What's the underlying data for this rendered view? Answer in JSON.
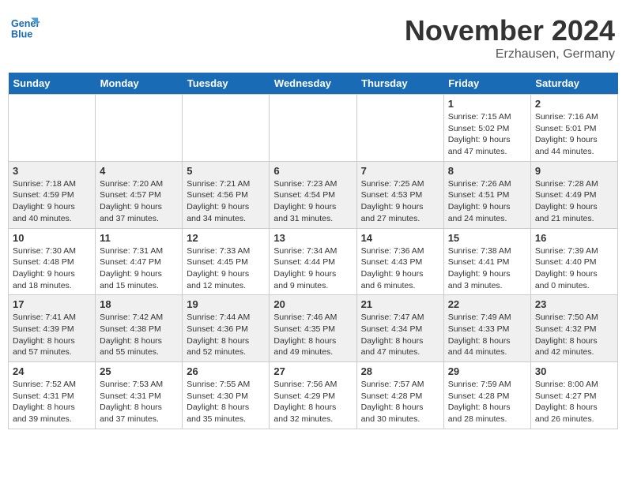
{
  "header": {
    "title": "November 2024",
    "location": "Erzhausen, Germany",
    "logo_line1": "General",
    "logo_line2": "Blue"
  },
  "days_of_week": [
    "Sunday",
    "Monday",
    "Tuesday",
    "Wednesday",
    "Thursday",
    "Friday",
    "Saturday"
  ],
  "weeks": [
    [
      {
        "day": "",
        "info": ""
      },
      {
        "day": "",
        "info": ""
      },
      {
        "day": "",
        "info": ""
      },
      {
        "day": "",
        "info": ""
      },
      {
        "day": "",
        "info": ""
      },
      {
        "day": "1",
        "info": "Sunrise: 7:15 AM\nSunset: 5:02 PM\nDaylight: 9 hours and 47 minutes."
      },
      {
        "day": "2",
        "info": "Sunrise: 7:16 AM\nSunset: 5:01 PM\nDaylight: 9 hours and 44 minutes."
      }
    ],
    [
      {
        "day": "3",
        "info": "Sunrise: 7:18 AM\nSunset: 4:59 PM\nDaylight: 9 hours and 40 minutes."
      },
      {
        "day": "4",
        "info": "Sunrise: 7:20 AM\nSunset: 4:57 PM\nDaylight: 9 hours and 37 minutes."
      },
      {
        "day": "5",
        "info": "Sunrise: 7:21 AM\nSunset: 4:56 PM\nDaylight: 9 hours and 34 minutes."
      },
      {
        "day": "6",
        "info": "Sunrise: 7:23 AM\nSunset: 4:54 PM\nDaylight: 9 hours and 31 minutes."
      },
      {
        "day": "7",
        "info": "Sunrise: 7:25 AM\nSunset: 4:53 PM\nDaylight: 9 hours and 27 minutes."
      },
      {
        "day": "8",
        "info": "Sunrise: 7:26 AM\nSunset: 4:51 PM\nDaylight: 9 hours and 24 minutes."
      },
      {
        "day": "9",
        "info": "Sunrise: 7:28 AM\nSunset: 4:49 PM\nDaylight: 9 hours and 21 minutes."
      }
    ],
    [
      {
        "day": "10",
        "info": "Sunrise: 7:30 AM\nSunset: 4:48 PM\nDaylight: 9 hours and 18 minutes."
      },
      {
        "day": "11",
        "info": "Sunrise: 7:31 AM\nSunset: 4:47 PM\nDaylight: 9 hours and 15 minutes."
      },
      {
        "day": "12",
        "info": "Sunrise: 7:33 AM\nSunset: 4:45 PM\nDaylight: 9 hours and 12 minutes."
      },
      {
        "day": "13",
        "info": "Sunrise: 7:34 AM\nSunset: 4:44 PM\nDaylight: 9 hours and 9 minutes."
      },
      {
        "day": "14",
        "info": "Sunrise: 7:36 AM\nSunset: 4:43 PM\nDaylight: 9 hours and 6 minutes."
      },
      {
        "day": "15",
        "info": "Sunrise: 7:38 AM\nSunset: 4:41 PM\nDaylight: 9 hours and 3 minutes."
      },
      {
        "day": "16",
        "info": "Sunrise: 7:39 AM\nSunset: 4:40 PM\nDaylight: 9 hours and 0 minutes."
      }
    ],
    [
      {
        "day": "17",
        "info": "Sunrise: 7:41 AM\nSunset: 4:39 PM\nDaylight: 8 hours and 57 minutes."
      },
      {
        "day": "18",
        "info": "Sunrise: 7:42 AM\nSunset: 4:38 PM\nDaylight: 8 hours and 55 minutes."
      },
      {
        "day": "19",
        "info": "Sunrise: 7:44 AM\nSunset: 4:36 PM\nDaylight: 8 hours and 52 minutes."
      },
      {
        "day": "20",
        "info": "Sunrise: 7:46 AM\nSunset: 4:35 PM\nDaylight: 8 hours and 49 minutes."
      },
      {
        "day": "21",
        "info": "Sunrise: 7:47 AM\nSunset: 4:34 PM\nDaylight: 8 hours and 47 minutes."
      },
      {
        "day": "22",
        "info": "Sunrise: 7:49 AM\nSunset: 4:33 PM\nDaylight: 8 hours and 44 minutes."
      },
      {
        "day": "23",
        "info": "Sunrise: 7:50 AM\nSunset: 4:32 PM\nDaylight: 8 hours and 42 minutes."
      }
    ],
    [
      {
        "day": "24",
        "info": "Sunrise: 7:52 AM\nSunset: 4:31 PM\nDaylight: 8 hours and 39 minutes."
      },
      {
        "day": "25",
        "info": "Sunrise: 7:53 AM\nSunset: 4:31 PM\nDaylight: 8 hours and 37 minutes."
      },
      {
        "day": "26",
        "info": "Sunrise: 7:55 AM\nSunset: 4:30 PM\nDaylight: 8 hours and 35 minutes."
      },
      {
        "day": "27",
        "info": "Sunrise: 7:56 AM\nSunset: 4:29 PM\nDaylight: 8 hours and 32 minutes."
      },
      {
        "day": "28",
        "info": "Sunrise: 7:57 AM\nSunset: 4:28 PM\nDaylight: 8 hours and 30 minutes."
      },
      {
        "day": "29",
        "info": "Sunrise: 7:59 AM\nSunset: 4:28 PM\nDaylight: 8 hours and 28 minutes."
      },
      {
        "day": "30",
        "info": "Sunrise: 8:00 AM\nSunset: 4:27 PM\nDaylight: 8 hours and 26 minutes."
      }
    ]
  ],
  "accent_color": "#1a6bb5"
}
